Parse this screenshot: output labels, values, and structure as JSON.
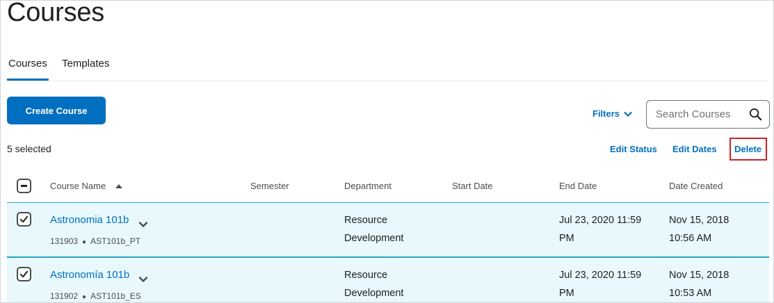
{
  "page": {
    "title": "Courses"
  },
  "tabs": [
    {
      "label": "Courses",
      "active": true
    },
    {
      "label": "Templates",
      "active": false
    }
  ],
  "toolbar": {
    "create_label": "Create Course",
    "filters_label": "Filters",
    "search_placeholder": "Search Courses"
  },
  "selection": {
    "count_text": "5 selected",
    "actions": {
      "edit_status": "Edit Status",
      "edit_dates": "Edit Dates",
      "delete": "Delete"
    }
  },
  "table": {
    "columns": {
      "course_name": "Course Name",
      "semester": "Semester",
      "department": "Department",
      "start_date": "Start Date",
      "end_date": "End Date",
      "date_created": "Date Created"
    },
    "rows": [
      {
        "name": "Astronomia 101b",
        "code": "131903",
        "offering": "AST101b_PT",
        "semester": "",
        "department": "Resource Development",
        "start_date": "",
        "end_date": "Jul 23, 2020 11:59 PM",
        "date_created": "Nov 15, 2018 10:56 AM",
        "checked": true
      },
      {
        "name": "Astronomía 101b",
        "code": "131902",
        "offering": "AST101b_ES",
        "semester": "",
        "department": "Resource Development",
        "start_date": "",
        "end_date": "Jul 23, 2020 11:59 PM",
        "date_created": "Nov 15, 2018 10:53 AM",
        "checked": true
      }
    ]
  },
  "colors": {
    "accent": "#006fbf",
    "row_selected_bg": "#e8f8fc",
    "row_selected_border": "#2aa2bc",
    "highlight_box": "#cd2026"
  }
}
